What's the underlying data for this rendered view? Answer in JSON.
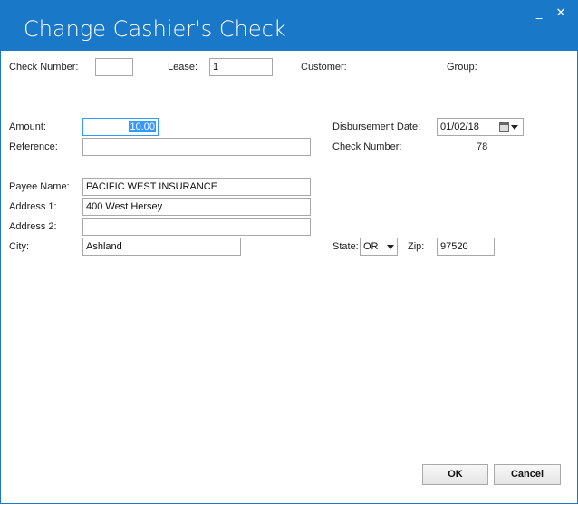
{
  "window": {
    "title": "Change Cashier's Check",
    "minimize_glyph": "_",
    "close_glyph": "✕"
  },
  "header": {
    "check_number_label": "Check Number:",
    "check_number_value": "",
    "lease_label": "Lease:",
    "lease_value": "1",
    "customer_label": "Customer:",
    "group_label": "Group:"
  },
  "details": {
    "amount_label": "Amount:",
    "amount_value": "10.00",
    "reference_label": "Reference:",
    "reference_value": "",
    "disbursement_date_label": "Disbursement Date:",
    "disbursement_date_value": "01/02/18",
    "check_number_label": "Check Number:",
    "check_number_value": "78"
  },
  "payee": {
    "name_label": "Payee Name:",
    "name_value": "PACIFIC WEST INSURANCE",
    "address1_label": "Address 1:",
    "address1_value": "400 West Hersey",
    "address2_label": "Address 2:",
    "address2_value": "",
    "city_label": "City:",
    "city_value": "Ashland",
    "state_label": "State:",
    "state_value": "OR",
    "zip_label": "Zip:",
    "zip_value": "97520"
  },
  "buttons": {
    "ok_label": "OK",
    "cancel_label": "Cancel"
  },
  "colors": {
    "titlebar": "#1a78c8",
    "selection": "#3399ff"
  }
}
